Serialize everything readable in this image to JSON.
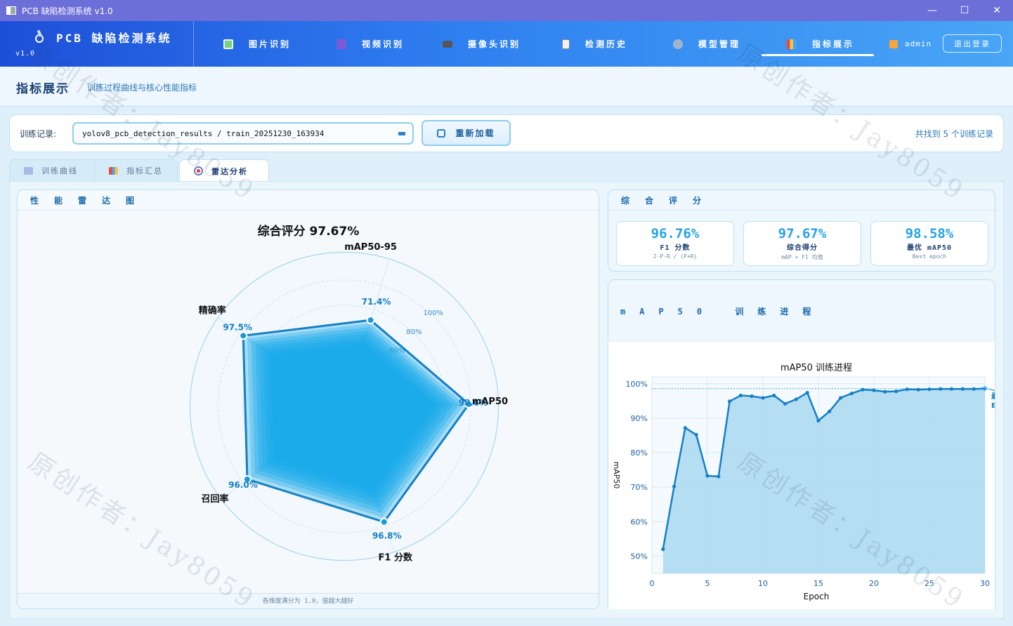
{
  "window": {
    "title": "PCB 缺陷检测系统 v1.0",
    "minimize": "—",
    "maximize": "☐",
    "close": "✕"
  },
  "header": {
    "logo_title": "PCB 缺陷检测系统",
    "version": "v1.0",
    "nav": [
      {
        "label": "图片识别",
        "icon": "image-icon"
      },
      {
        "label": "视频识别",
        "icon": "video-icon"
      },
      {
        "label": "摄像头识别",
        "icon": "camera-icon"
      },
      {
        "label": "检测历史",
        "icon": "history-icon"
      },
      {
        "label": "模型管理",
        "icon": "gear-icon"
      },
      {
        "label": "指标展示",
        "icon": "metrics-icon",
        "active": true
      }
    ],
    "user": "admin",
    "logout": "退出登录"
  },
  "page": {
    "title": "指标展示",
    "subtitle": "训练过程曲线与核心性能指标"
  },
  "record": {
    "label": "训练记录:",
    "selected": "yolov8_pcb_detection_results / train_20251230_163934",
    "reload": "重新加载",
    "count_text": "共找到 5 个训练记录"
  },
  "tabs": [
    {
      "label": "训练曲线",
      "icon": "line-chart-icon"
    },
    {
      "label": "指标汇总",
      "icon": "bar-chart-icon"
    },
    {
      "label": "雷达分析",
      "icon": "target-icon",
      "active": true
    }
  ],
  "radar_card": {
    "title": "性能雷达图",
    "footer": "各维度满分为 1.0，值越大越好"
  },
  "score_card": {
    "title": "综合评分",
    "metrics": [
      {
        "value": "96.76%",
        "label": "F1 分数",
        "sub": "2·P·R / (P+R)"
      },
      {
        "value": "97.67%",
        "label": "综合得分",
        "sub": "mAP + F1 均值"
      },
      {
        "value": "98.58%",
        "label": "最优 mAP50",
        "sub": "Best epoch"
      }
    ]
  },
  "map_card": {
    "title": "mAP50 训练进程"
  },
  "watermark": "原创作者：Jay8059",
  "colors": {
    "accent": "#1e88c8",
    "fill": "#14a7e8",
    "header_start": "#1d4fd8",
    "header_end": "#48a6f5"
  },
  "chart_data": [
    {
      "type": "radar",
      "title": "综合评分  97.67%",
      "axes": [
        "mAP50-95",
        "mAP50",
        "F1 分数",
        "召回率",
        "精确率"
      ],
      "values": [
        71.4,
        98.6,
        96.8,
        96.0,
        97.5
      ],
      "value_labels": [
        "71.4%",
        "98.6%",
        "96.8%",
        "96.0%",
        "97.5%"
      ],
      "ring_labels": [
        "60%",
        "80%",
        "100%"
      ],
      "range": [
        0,
        100
      ]
    },
    {
      "type": "area",
      "title": "mAP50 训练进程",
      "xlabel": "Epoch",
      "ylabel": "mAP50",
      "x": [
        1,
        2,
        3,
        4,
        5,
        6,
        7,
        8,
        9,
        10,
        11,
        12,
        13,
        14,
        15,
        16,
        17,
        18,
        19,
        20,
        21,
        22,
        23,
        24,
        25,
        26,
        27,
        28,
        29,
        30
      ],
      "values": [
        52.0,
        70.2,
        87.2,
        85.2,
        73.3,
        73.1,
        94.9,
        96.6,
        96.4,
        95.9,
        96.6,
        94.2,
        95.5,
        97.4,
        89.3,
        92.0,
        95.9,
        97.2,
        98.3,
        98.1,
        97.7,
        97.8,
        98.4,
        98.3,
        98.4,
        98.5,
        98.5,
        98.5,
        98.5,
        98.58
      ],
      "xlim": [
        0,
        30
      ],
      "ylim": [
        45,
        102
      ],
      "xticks": [
        "0",
        "5",
        "10",
        "15",
        "20",
        "25",
        "30"
      ],
      "yticks": [
        "50%",
        "60%",
        "70%",
        "80%",
        "90%",
        "100%"
      ],
      "best_value": 98.58,
      "best_annotation": "最\nEp",
      "grid": true
    }
  ]
}
